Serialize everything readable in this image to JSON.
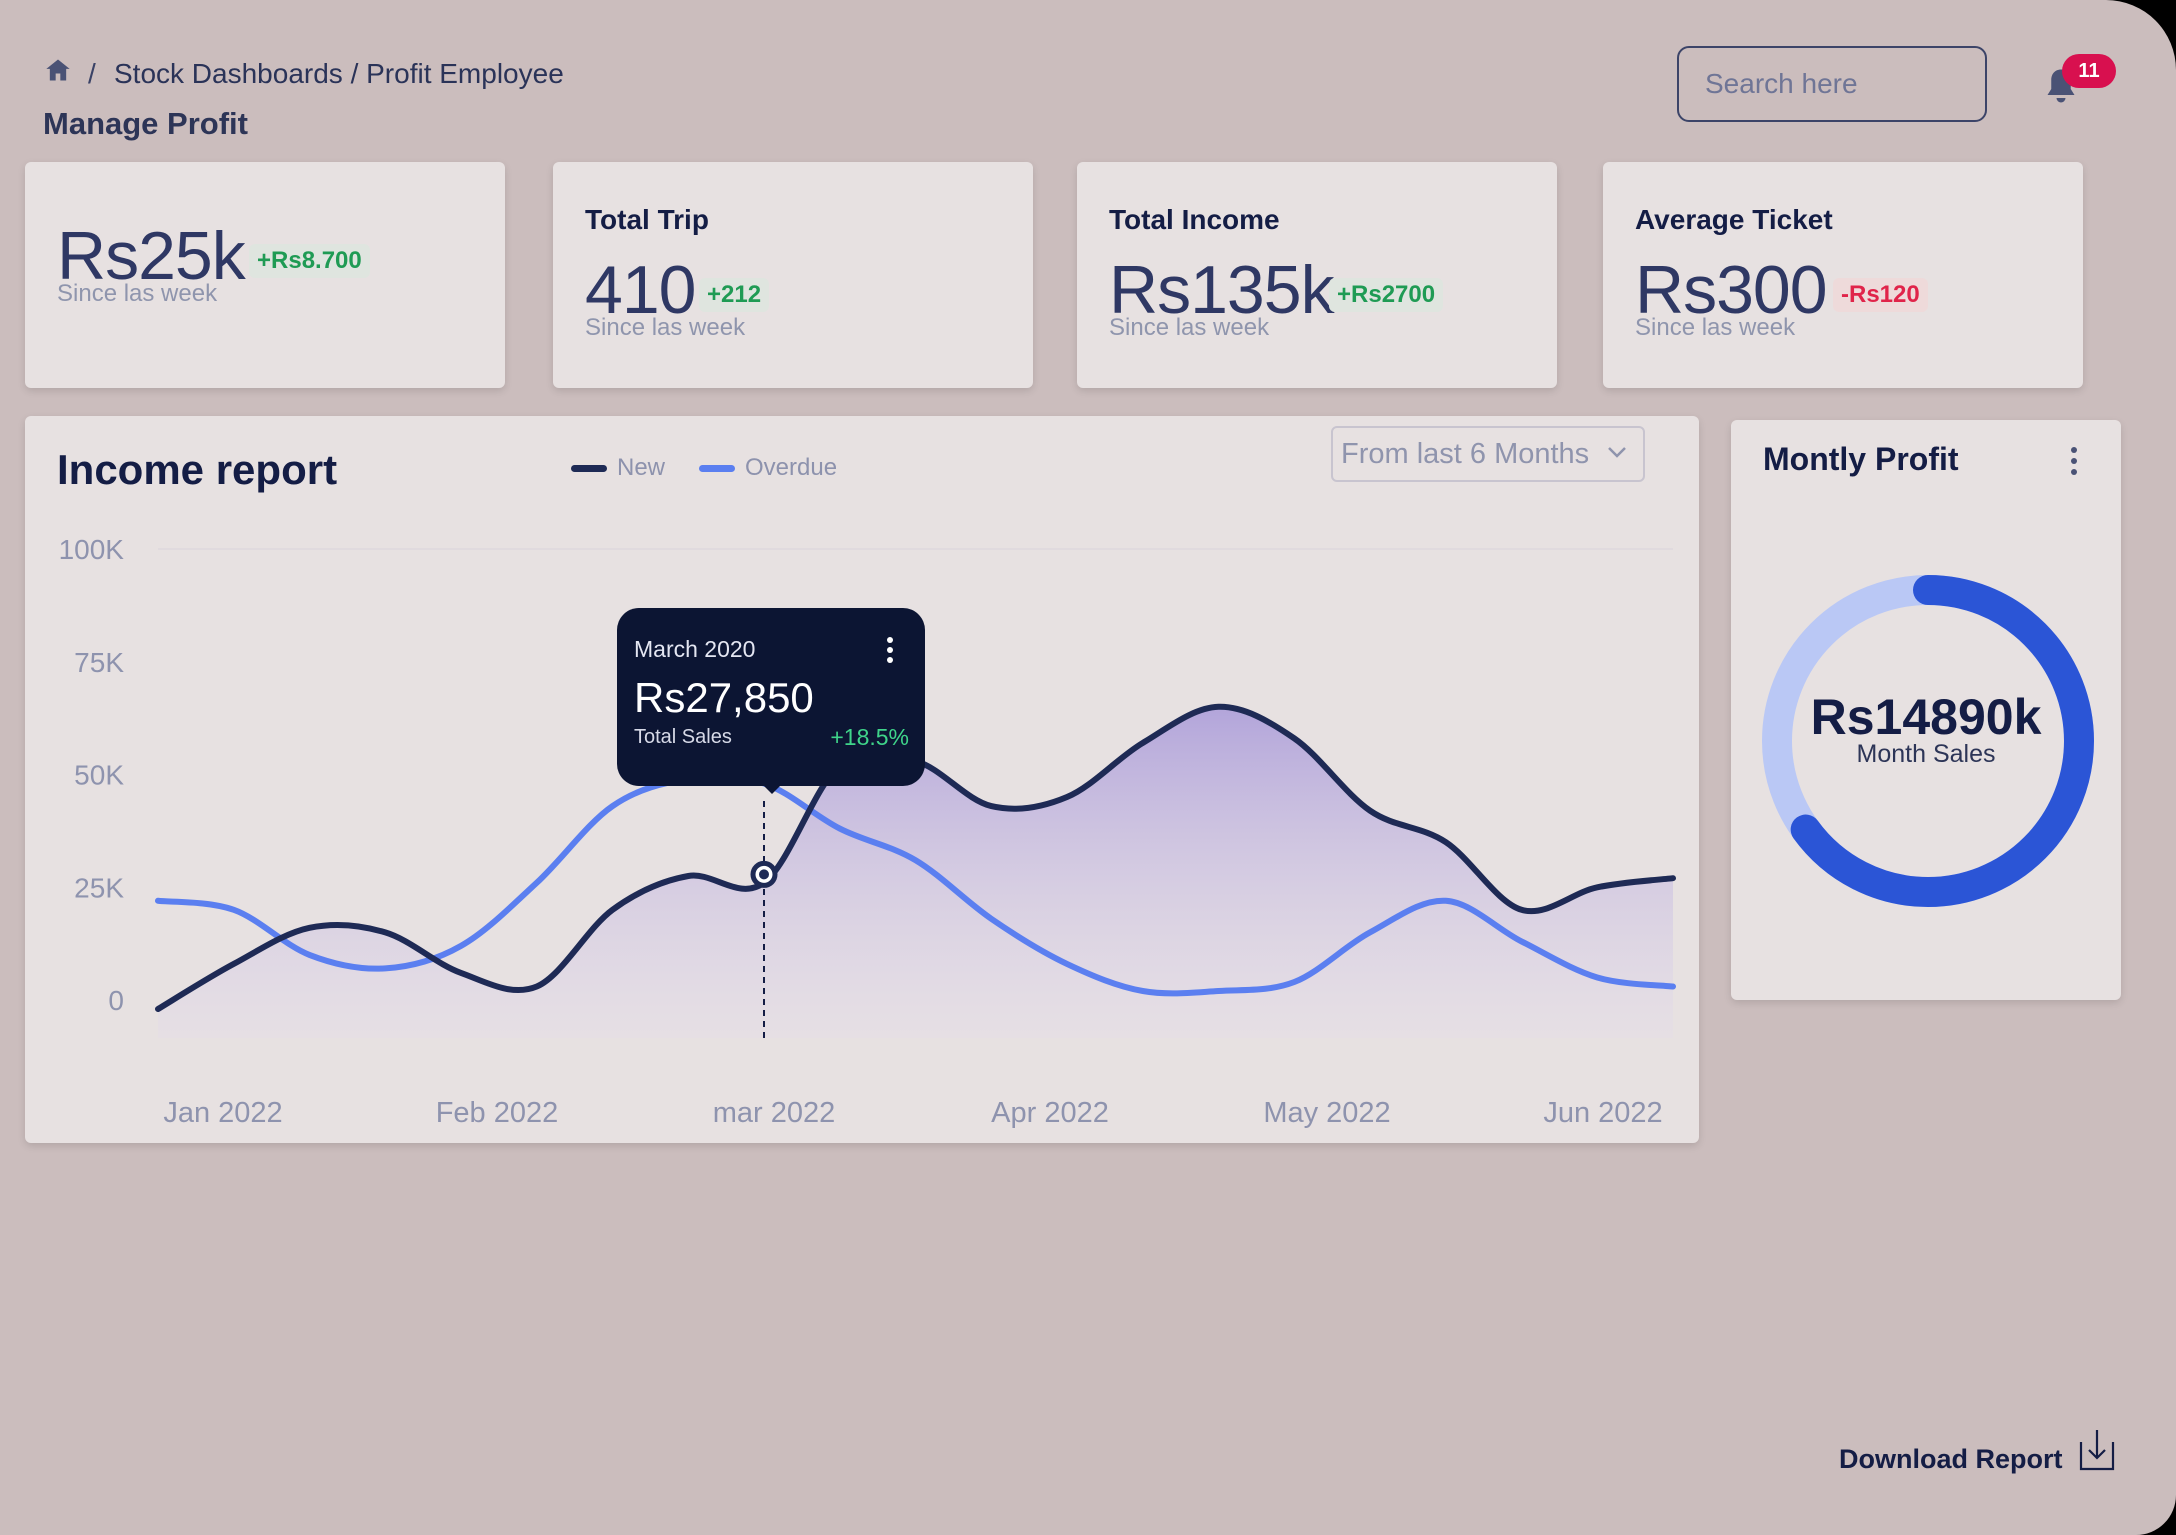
{
  "breadcrumb": {
    "home_icon": "home-icon",
    "separator": "/",
    "path": "Stock Dashboards / Profit Employee"
  },
  "page_title": "Manage Profit",
  "search": {
    "placeholder": "Search here"
  },
  "notifications": {
    "icon": "bell-icon",
    "count": "11",
    "badge_color": "#d8104f"
  },
  "stats": [
    {
      "title": "",
      "value": "Rs25k",
      "delta": "+Rs8.700",
      "trend": "up",
      "subtitle": "Since las week"
    },
    {
      "title": "Total Trip",
      "value": "410",
      "delta": "+212",
      "trend": "up",
      "subtitle": "Since las week"
    },
    {
      "title": "Total Income",
      "value": "Rs135k",
      "delta": "+Rs2700",
      "trend": "up",
      "subtitle": "Since las week"
    },
    {
      "title": "Average Ticket",
      "value": "Rs300",
      "delta": "-Rs120",
      "trend": "down",
      "subtitle": "Since las week"
    }
  ],
  "income_report": {
    "title": "Income report",
    "legend": [
      {
        "label": "New",
        "color": "#1e2a55"
      },
      {
        "label": "Overdue",
        "color": "#5b7ff0"
      }
    ],
    "range_select": {
      "value": "From last 6 Months",
      "icon": "chevron-down-icon"
    },
    "tooltip": {
      "date": "March 2020",
      "value": "Rs27,850",
      "label": "Total Sales",
      "change": "+18.5%",
      "icon": "more-vertical-icon"
    }
  },
  "chart_data": {
    "type": "line",
    "x": [
      "Jan 2022",
      "",
      "",
      "",
      "Feb 2022",
      "",
      "",
      "",
      "mar 2022",
      "",
      "",
      "",
      "Apr 2022",
      "",
      "",
      "",
      "May 2022",
      "",
      "",
      "",
      "Jun 2022"
    ],
    "x_tick_labels": [
      "Jan 2022",
      "Feb 2022",
      "mar 2022",
      "Apr 2022",
      "May 2022",
      "Jun 2022"
    ],
    "y_tick_labels": [
      "100K",
      "75K",
      "50K",
      "25K",
      "0"
    ],
    "ylim": [
      0,
      100000
    ],
    "series": [
      {
        "name": "New",
        "color": "#1e2a55",
        "fill": true,
        "values": [
          -2000,
          8000,
          16000,
          15000,
          6000,
          3000,
          20000,
          27500,
          26000,
          52000,
          53000,
          43000,
          45000,
          57000,
          65000,
          58000,
          42000,
          35000,
          20000,
          25000,
          27000
        ]
      },
      {
        "name": "Overdue",
        "color": "#5b7ff0",
        "fill": false,
        "values": [
          22000,
          20000,
          10000,
          7000,
          12000,
          26000,
          43000,
          49000,
          48000,
          38000,
          31000,
          18000,
          8000,
          2000,
          2000,
          4000,
          15000,
          22000,
          13000,
          5000,
          3000
        ]
      }
    ],
    "highlight": {
      "index": 8,
      "value": 27850
    },
    "grid": "top-line-only",
    "legend_position": "top-center"
  },
  "monthly_profit": {
    "title": "Montly Profit",
    "value": "Rs14890k",
    "label": "Month Sales",
    "share": 0.65,
    "colors": {
      "fill": "#2b55d6",
      "track": "#bac8f5"
    },
    "icon": "more-vertical-icon"
  },
  "download": {
    "label": "Download Report",
    "icon": "download-icon"
  }
}
